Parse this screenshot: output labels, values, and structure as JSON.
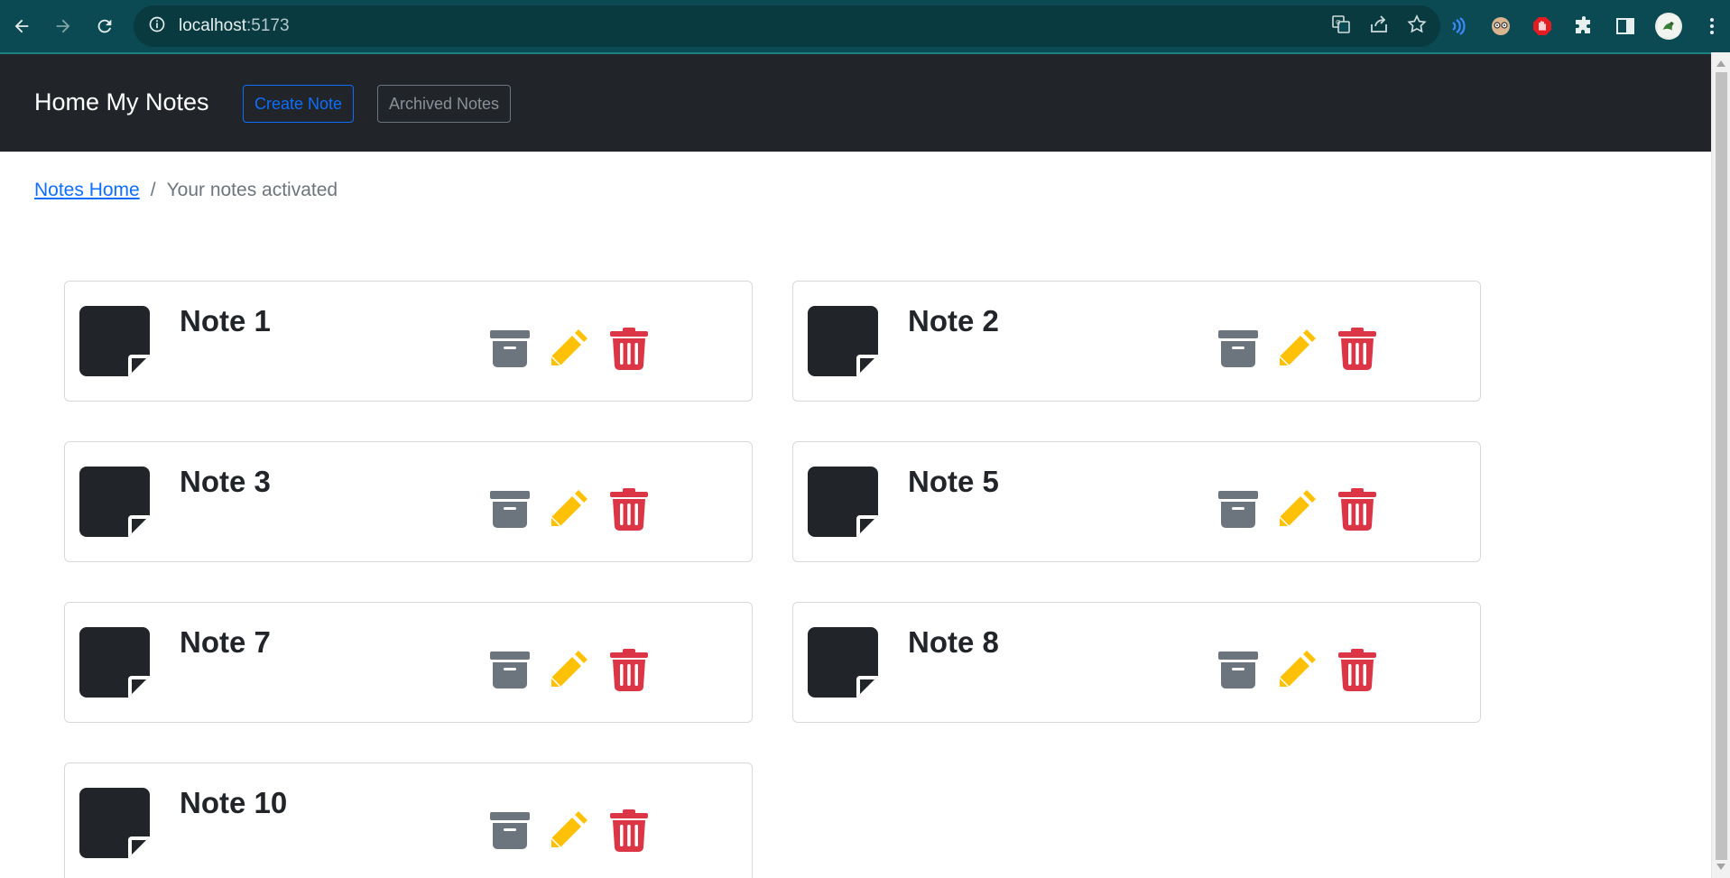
{
  "browser": {
    "url_host": "localhost",
    "url_port": ":5173"
  },
  "navbar": {
    "brand": "Home My Notes",
    "create_label": "Create Note",
    "archived_label": "Archived Notes"
  },
  "breadcrumb": {
    "home_label": "Notes Home",
    "separator": "/",
    "current": "Your notes activated"
  },
  "notes": [
    {
      "title": "Note 1"
    },
    {
      "title": "Note 2"
    },
    {
      "title": "Note 3"
    },
    {
      "title": "Note 5"
    },
    {
      "title": "Note 7"
    },
    {
      "title": "Note 8"
    },
    {
      "title": "Note 10"
    }
  ],
  "icons": {
    "archive": "archive-icon",
    "edit": "pencil-icon",
    "delete": "trash-icon",
    "note": "sticky-note-icon"
  },
  "colors": {
    "archive": "#6c757d",
    "edit": "#ffc107",
    "delete": "#dc3545",
    "primary": "#0d6efd",
    "navbar": "#212529"
  }
}
